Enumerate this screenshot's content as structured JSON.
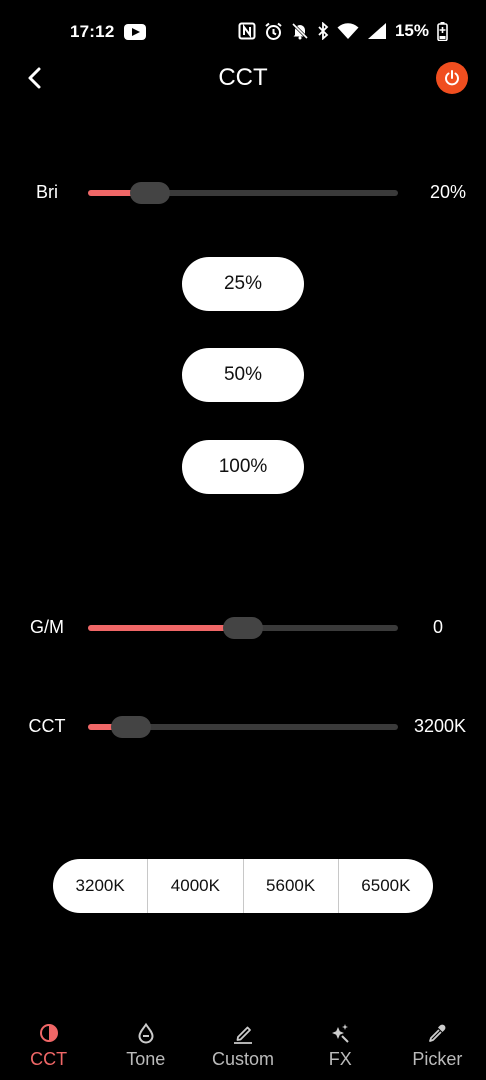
{
  "status_bar": {
    "time": "17:12",
    "battery": "15%"
  },
  "header": {
    "title": "CCT"
  },
  "colors": {
    "accent": "#f06767",
    "power": "#f04e1f",
    "track": "#3a3a3a",
    "thumb": "#444444"
  },
  "sliders": {
    "brightness": {
      "label": "Bri",
      "value_text": "20%",
      "fraction": 0.2
    },
    "gm": {
      "label": "G/M",
      "value_text": "0",
      "fraction": 0.5
    },
    "cct": {
      "label": "CCT",
      "value_text": "3200K",
      "fraction": 0.14
    }
  },
  "brightness_presets": [
    "25%",
    "50%",
    "100%"
  ],
  "cct_presets": [
    "3200K",
    "4000K",
    "5600K",
    "6500K"
  ],
  "bottom_nav": {
    "items": [
      {
        "label": "CCT",
        "icon": "half-circle-icon",
        "active": true
      },
      {
        "label": "Tone",
        "icon": "drop-icon",
        "active": false
      },
      {
        "label": "Custom",
        "icon": "pencil-icon",
        "active": false
      },
      {
        "label": "FX",
        "icon": "sparkle-icon",
        "active": false
      },
      {
        "label": "Picker",
        "icon": "eyedropper-icon",
        "active": false
      }
    ]
  }
}
